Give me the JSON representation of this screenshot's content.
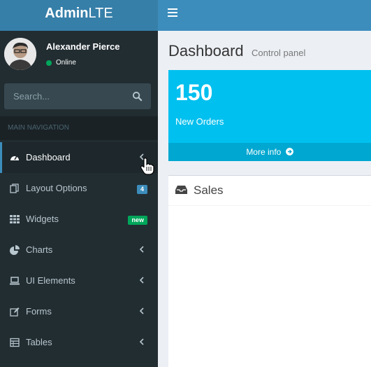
{
  "header": {
    "logo_bold": "Admin",
    "logo_light": "LTE"
  },
  "user": {
    "name": "Alexander Pierce",
    "status": "Online"
  },
  "search": {
    "placeholder": "Search..."
  },
  "sidebar": {
    "nav_header": "MAIN NAVIGATION",
    "items": [
      {
        "label": "Dashboard",
        "icon": "dashboard-icon"
      },
      {
        "label": "Layout Options",
        "icon": "files-icon",
        "badge": "4"
      },
      {
        "label": "Widgets",
        "icon": "grid-icon",
        "badge": "new"
      },
      {
        "label": "Charts",
        "icon": "pie-chart-icon"
      },
      {
        "label": "UI Elements",
        "icon": "laptop-icon"
      },
      {
        "label": "Forms",
        "icon": "edit-icon"
      },
      {
        "label": "Tables",
        "icon": "table-icon"
      }
    ]
  },
  "content": {
    "title": "Dashboard",
    "subtitle": "Control panel",
    "info_box": {
      "value": "150",
      "text": "New Orders",
      "link": "More info"
    },
    "sales_box": {
      "title": "Sales"
    }
  },
  "colors": {
    "brand": "#3c8dbc",
    "logo_bg": "#367fa9",
    "sidebar_bg": "#222d32",
    "info_bg": "#00c0ef",
    "online": "#00a65a"
  }
}
